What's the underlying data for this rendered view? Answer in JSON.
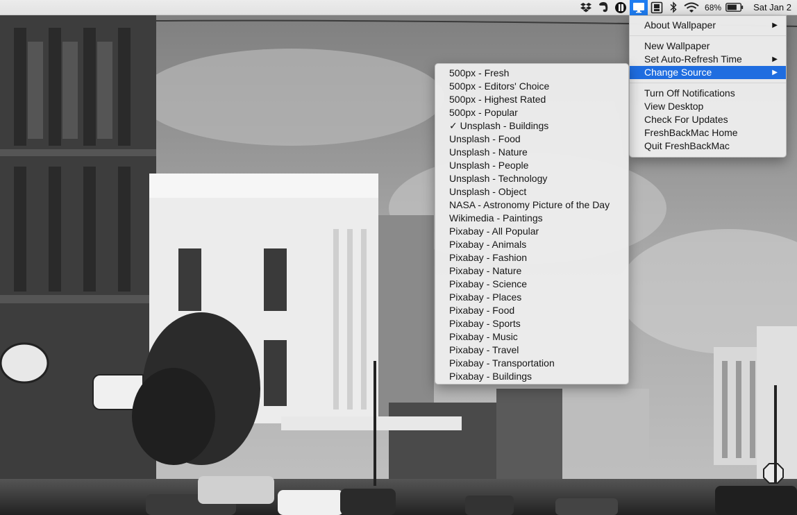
{
  "menubar": {
    "battery_percent": "68%",
    "clock": "Sat Jan 2",
    "icons": [
      "dropbox-icon",
      "evernote-icon",
      "1password-icon",
      "freshback-icon",
      "screenshot-tool-icon",
      "bluetooth-icon",
      "wifi-icon",
      "battery-icon"
    ]
  },
  "main_menu": {
    "items": [
      {
        "label": "About Wallpaper",
        "submenu": true
      },
      {
        "label": "New Wallpaper"
      },
      {
        "label": "Set Auto-Refresh Time",
        "submenu": true
      },
      {
        "label": "Change Source",
        "submenu": true,
        "selected": true
      },
      {
        "label": "Turn Off Notifications"
      },
      {
        "label": "View Desktop"
      },
      {
        "label": "Check For Updates"
      },
      {
        "label": "FreshBackMac Home"
      },
      {
        "label": "Quit FreshBackMac"
      }
    ],
    "submenu_arrow": "▶"
  },
  "source_menu": {
    "checkmark": "✓",
    "items": [
      {
        "label": "500px - Fresh"
      },
      {
        "label": "500px - Editors' Choice"
      },
      {
        "label": "500px - Highest Rated"
      },
      {
        "label": "500px - Popular"
      },
      {
        "label": "Unsplash - Buildings",
        "checked": true
      },
      {
        "label": "Unsplash - Food"
      },
      {
        "label": "Unsplash - Nature"
      },
      {
        "label": "Unsplash - People"
      },
      {
        "label": "Unsplash - Technology"
      },
      {
        "label": "Unsplash - Object"
      },
      {
        "label": "NASA - Astronomy Picture of the Day"
      },
      {
        "label": "Wikimedia - Paintings"
      },
      {
        "label": "Pixabay - All Popular"
      },
      {
        "label": "Pixabay - Animals"
      },
      {
        "label": "Pixabay - Fashion"
      },
      {
        "label": "Pixabay - Nature"
      },
      {
        "label": "Pixabay - Science"
      },
      {
        "label": "Pixabay - Places"
      },
      {
        "label": "Pixabay - Food"
      },
      {
        "label": "Pixabay - Sports"
      },
      {
        "label": "Pixabay - Music"
      },
      {
        "label": "Pixabay - Travel"
      },
      {
        "label": "Pixabay - Transportation"
      },
      {
        "label": "Pixabay - Buildings"
      }
    ]
  },
  "colors": {
    "selection": "#1f6de0",
    "menubar_app_active": "#1e7cf0"
  }
}
